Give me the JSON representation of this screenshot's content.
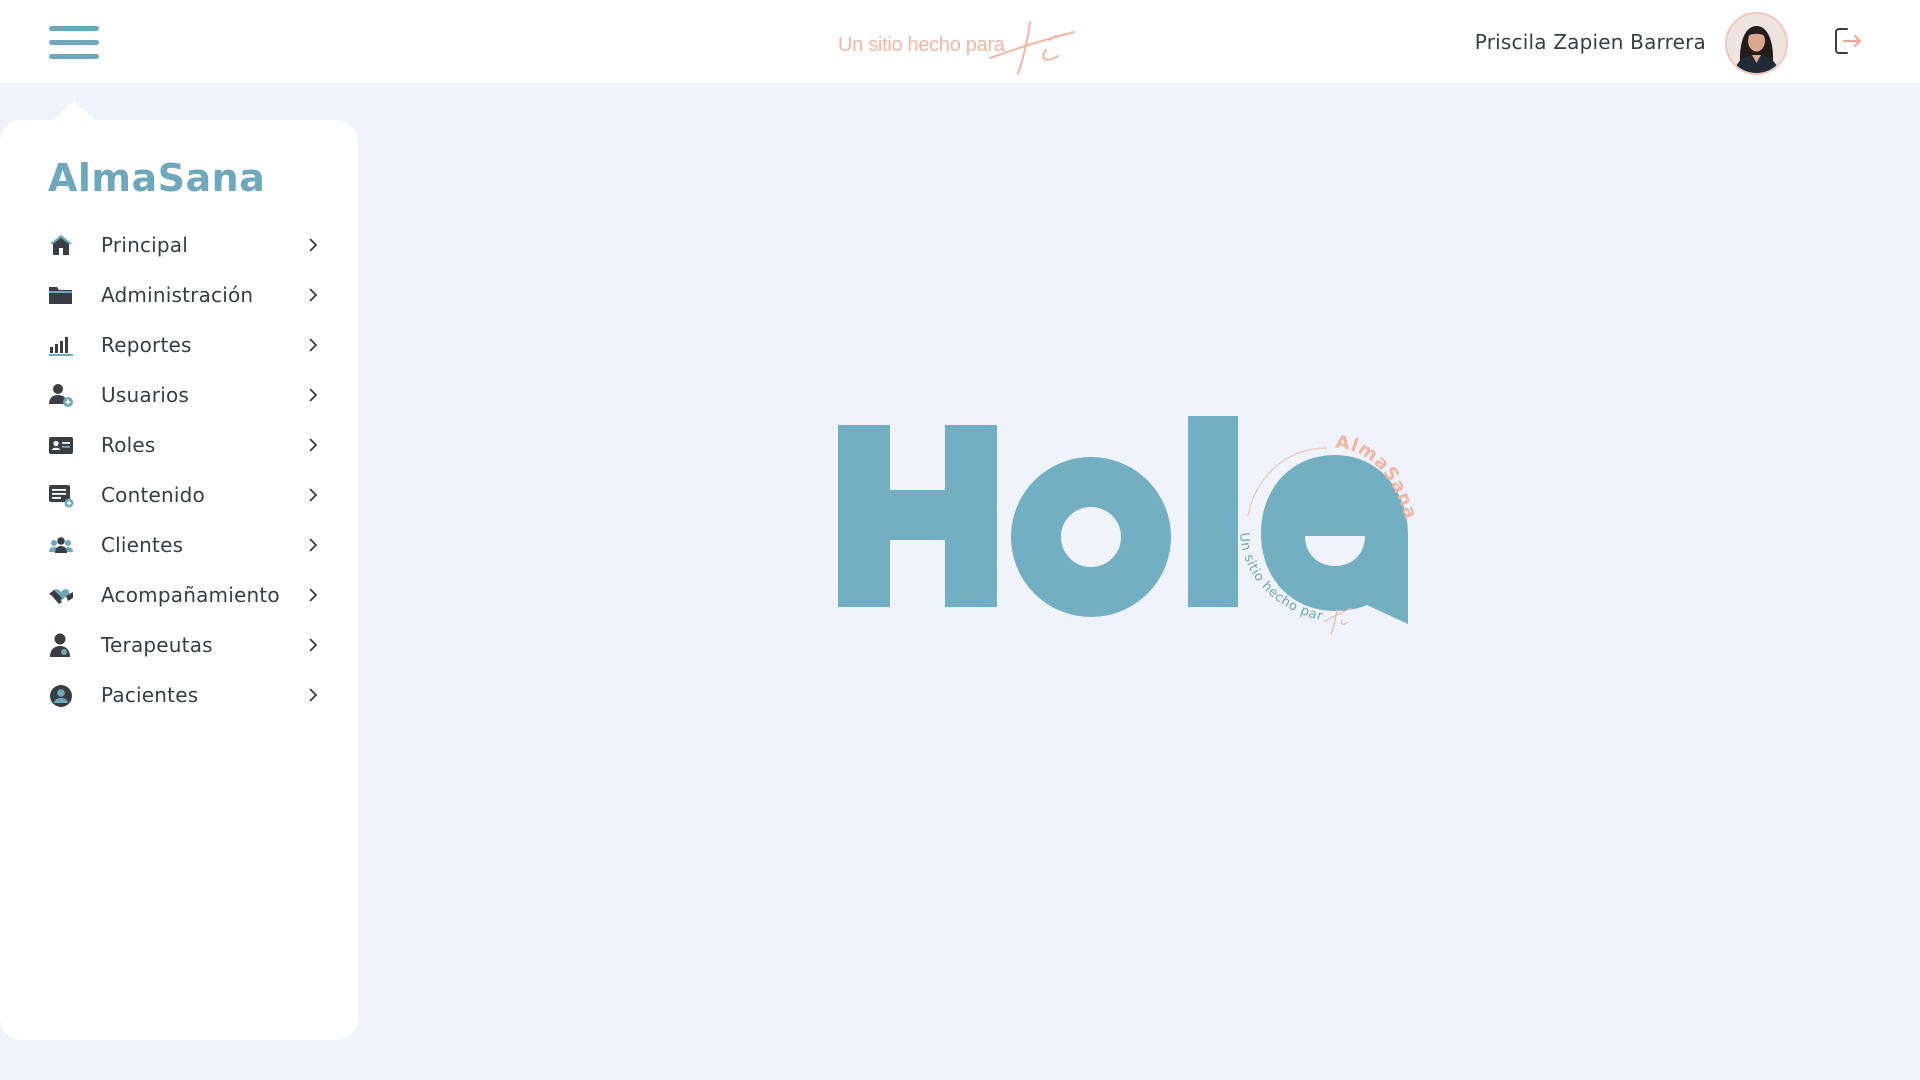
{
  "header": {
    "slogan_text": "Un sitio hecho para",
    "slogan_script": "ti",
    "user_name": "Priscila Zapien Barrera",
    "icons": {
      "menu": "hamburger-menu-icon",
      "logout": "logout-icon",
      "avatar": "user-avatar"
    }
  },
  "sidebar": {
    "brand": "AlmaSana",
    "items": [
      {
        "label": "Principal",
        "icon": "home-icon"
      },
      {
        "label": "Administración",
        "icon": "folder-icon"
      },
      {
        "label": "Reportes",
        "icon": "bar-chart-icon"
      },
      {
        "label": "Usuarios",
        "icon": "user-add-icon"
      },
      {
        "label": "Roles",
        "icon": "id-card-icon"
      },
      {
        "label": "Contenido",
        "icon": "content-add-icon"
      },
      {
        "label": "Clientes",
        "icon": "group-icon"
      },
      {
        "label": "Acompañamiento",
        "icon": "handshake-heart-icon"
      },
      {
        "label": "Terapeutas",
        "icon": "therapist-icon"
      },
      {
        "label": "Pacientes",
        "icon": "patient-icon"
      }
    ]
  },
  "hero": {
    "word": "Hola",
    "badge_brand": "AlmaSana",
    "badge_slogan": "Un sitio hecho para",
    "badge_script": "ti"
  },
  "colors": {
    "primary": "#6fa8bd",
    "accent": "#f2b6a5",
    "background": "#f0f3fb",
    "text": "#3a3d44"
  }
}
